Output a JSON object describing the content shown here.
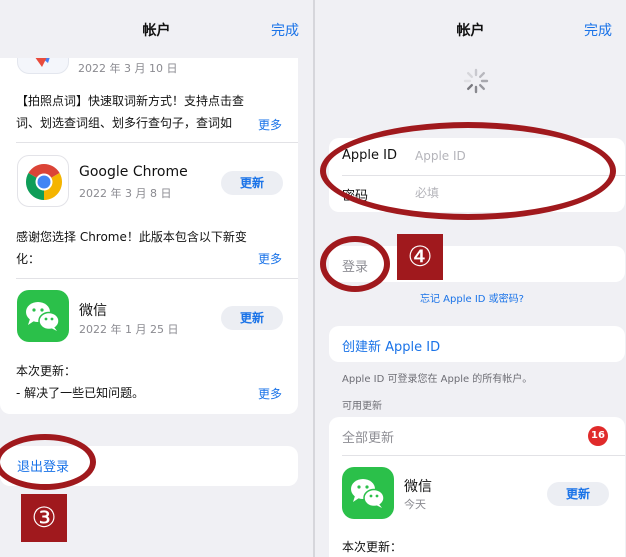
{
  "left": {
    "header": {
      "title": "帐户",
      "done": "完成"
    },
    "items": [
      {
        "date": "2022 年 3 月 10 日",
        "notes_line1": "【拍照点词】快速取词新方式！支持点击查",
        "notes_line2": "词、划选查词组、划多行查句子，查词如",
        "more": "更多"
      },
      {
        "name": "Google Chrome",
        "date": "2022 年 3 月 8 日",
        "button": "更新",
        "notes_line1": "感谢您选择 Chrome！此版本包含以下新变",
        "notes_line2": "化：",
        "more": "更多"
      },
      {
        "name": "微信",
        "date": "2022 年 1 月 25 日",
        "button": "更新",
        "notes_line1": "本次更新：",
        "notes_line2": "- 解决了一些已知问题。",
        "more": "更多"
      }
    ],
    "signout": "退出登录",
    "step": "③"
  },
  "right": {
    "header": {
      "title": "帐户",
      "done": "完成"
    },
    "fields": {
      "apple_id_label": "Apple ID",
      "apple_id_placeholder": "Apple ID",
      "password_label": "密码",
      "password_placeholder": "必填"
    },
    "signin": "登录",
    "step": "④",
    "forgot": "忘记 Apple ID 或密码?",
    "create": "创建新 Apple ID",
    "caption": "Apple ID 可登录您在 Apple 的所有帐户。",
    "available": "可用更新",
    "update_all": "全部更新",
    "update_count": "16",
    "app": {
      "name": "微信",
      "date": "今天",
      "button": "更新"
    },
    "notes": "本次更新："
  },
  "colors": {
    "accent": "#1a73e8",
    "annotation_red": "#a0191d",
    "badge_red": "#e02a2a",
    "background": "#f0f0f4"
  }
}
